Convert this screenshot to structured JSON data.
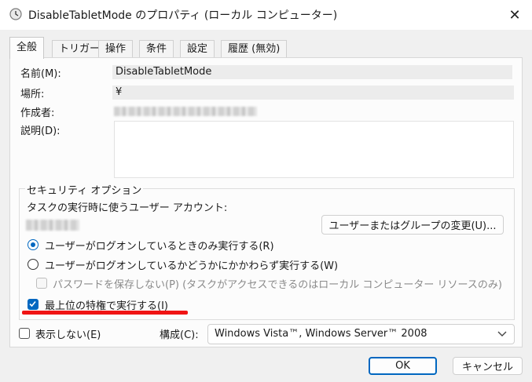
{
  "window": {
    "title": "DisableTabletMode のプロパティ (ローカル コンピューター)",
    "close_glyph": "✕"
  },
  "tabs": [
    {
      "label": "全般",
      "active": true
    },
    {
      "label": "トリガー",
      "active": false
    },
    {
      "label": "操作",
      "active": false
    },
    {
      "label": "条件",
      "active": false
    },
    {
      "label": "設定",
      "active": false
    },
    {
      "label": "履歴 (無効)",
      "active": false
    }
  ],
  "general": {
    "name_label": "名前(M):",
    "name_value": "DisableTabletMode",
    "location_label": "場所:",
    "location_value": "¥",
    "author_label": "作成者:",
    "description_label": "説明(D):",
    "description_value": ""
  },
  "security": {
    "group_title": "セキュリティ オプション",
    "account_label": "タスクの実行時に使うユーザー アカウント:",
    "change_user_button": "ユーザーまたはグループの変更(U)...",
    "radio_logged_on": "ユーザーがログオンしているときのみ実行する(R)",
    "radio_whether": "ユーザーがログオンしているかどうかにかかわらず実行する(W)",
    "no_password_label": "パスワードを保存しない(P) (タスクがアクセスできるのはローカル コンピューター リソースのみ)",
    "highest_priv_label": "最上位の特権で実行する(I)",
    "highest_priv_checked": true,
    "selected_radio": "logged_on"
  },
  "bottom": {
    "hidden_label": "表示しない(E)",
    "configure_label": "構成(C):",
    "configure_value": "Windows Vista™, Windows Server™ 2008"
  },
  "buttons": {
    "ok": "OK",
    "cancel": "キャンセル"
  },
  "colors": {
    "accent": "#0067c0",
    "annotation_red": "#f01414"
  }
}
